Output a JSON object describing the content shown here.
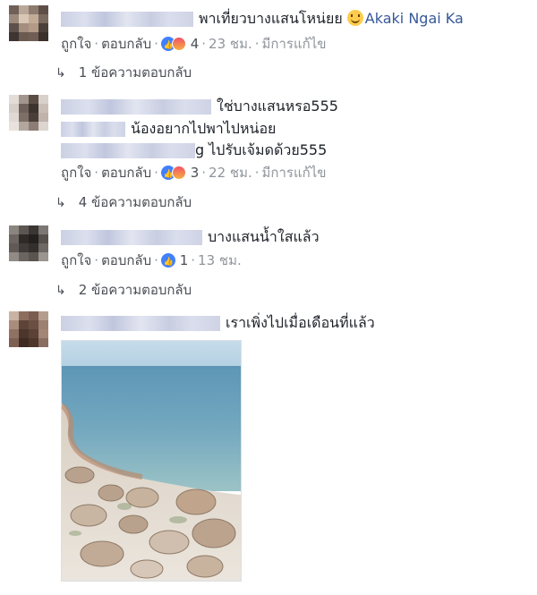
{
  "comments": [
    {
      "text": "พาเที่ยวบางแสนโหน่ยย",
      "tagged": "Akaki Ngai Ka",
      "like_label": "ถูกใจ",
      "reply_label": "ตอบกลับ",
      "reaction_count": "4",
      "time": "23 ชม.",
      "edited": "มีการแก้ไข",
      "replies_label": "1 ข้อความตอบกลับ"
    },
    {
      "text": "ใช่บางแสนหรอ555",
      "line2_text": "น้องอยากไปพาไปหน่อย",
      "line3_suffix": "g",
      "line3_text": "ไปรับเจ้มดด้วย555",
      "like_label": "ถูกใจ",
      "reply_label": "ตอบกลับ",
      "reaction_count": "3",
      "time": "22 ชม.",
      "edited": "มีการแก้ไข",
      "replies_label": "4 ข้อความตอบกลับ"
    },
    {
      "text": "บางแสนน้ำใสแล้ว",
      "like_label": "ถูกใจ",
      "reply_label": "ตอบกลับ",
      "reaction_count": "1",
      "time": "13 ชม.",
      "replies_label": "2 ข้อความตอบกลับ"
    },
    {
      "text": "เราเพิ่งไปเมื่อเดือนที่แล้ว"
    }
  ],
  "colors": {
    "link": "#365899",
    "meta": "#4b4f56",
    "muted": "#90949c",
    "like": "#4080ff"
  }
}
